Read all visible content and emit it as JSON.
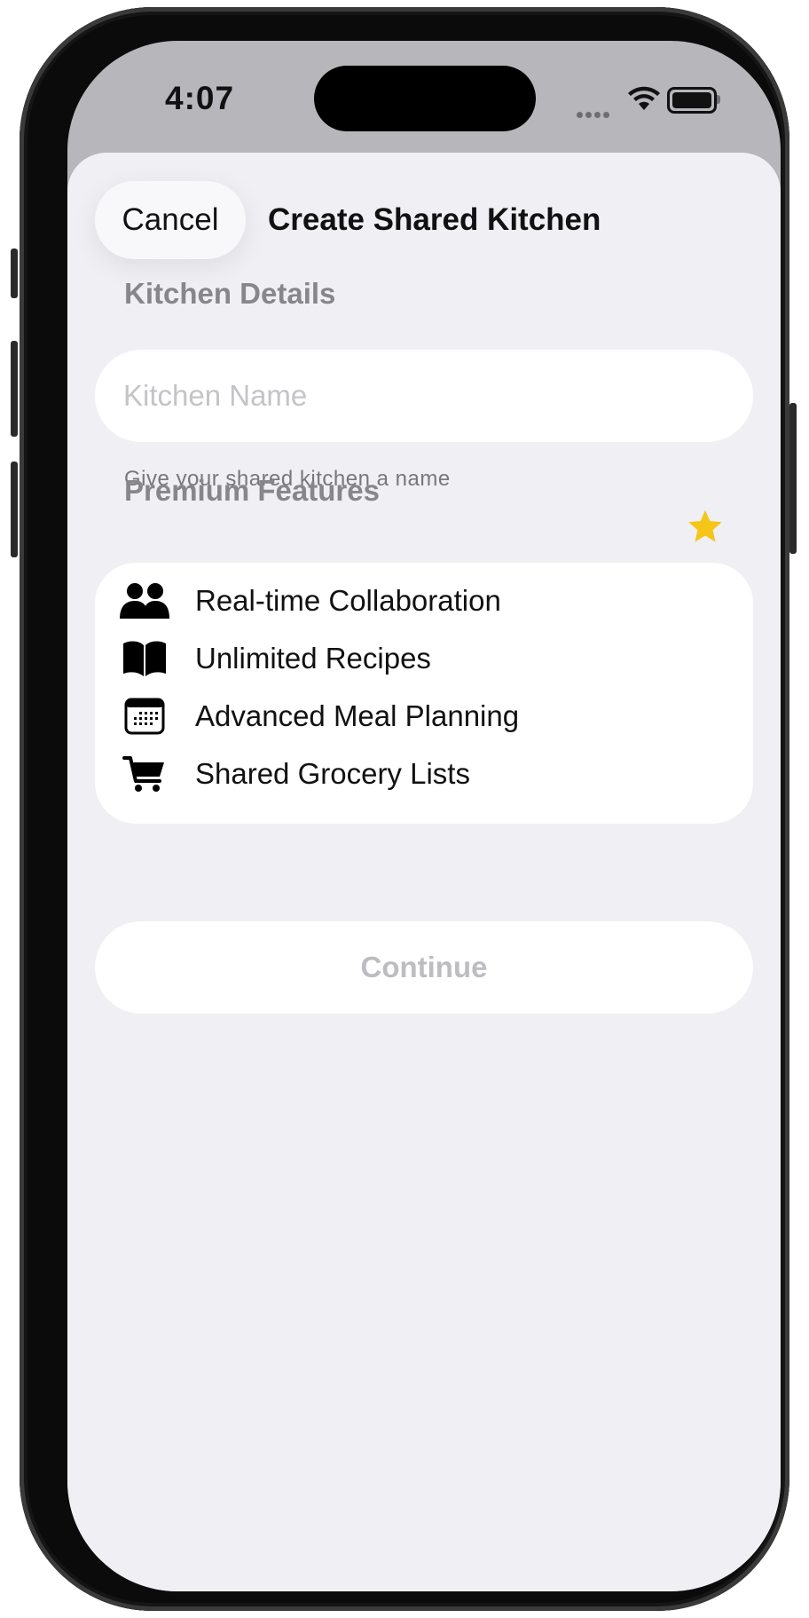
{
  "status_bar": {
    "time": "4:07"
  },
  "nav": {
    "cancel_label": "Cancel",
    "title": "Create Shared Kitchen"
  },
  "kitchen_details": {
    "heading": "Kitchen Details",
    "name_placeholder": "Kitchen Name",
    "name_value": "",
    "hint": "Give your shared kitchen a name"
  },
  "premium": {
    "heading": "Premium Features",
    "star_color": "#F5C518",
    "features": [
      {
        "label": "Real-time Collaboration",
        "icon": "people-icon"
      },
      {
        "label": "Unlimited Recipes",
        "icon": "book-icon"
      },
      {
        "label": "Advanced Meal Planning",
        "icon": "calendar-icon"
      },
      {
        "label": "Shared Grocery Lists",
        "icon": "cart-icon"
      }
    ]
  },
  "continue_label": "Continue",
  "colors": {
    "sheet_background": "#EFEFF4",
    "secondary_text": "#86868B",
    "disabled_text": "#BDBDC1"
  }
}
